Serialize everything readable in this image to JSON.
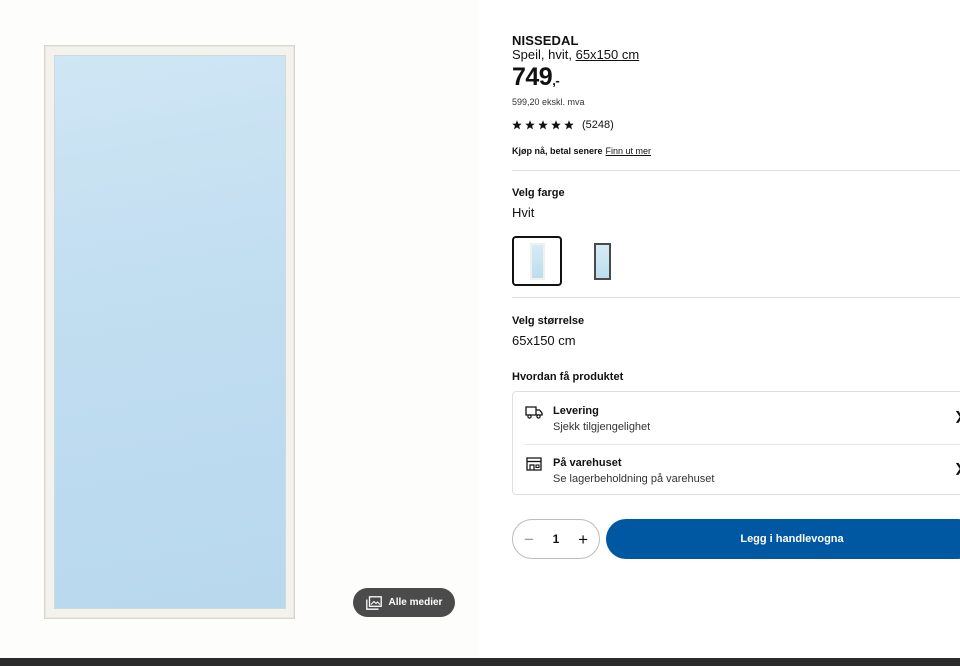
{
  "gallery": {
    "media_button_label": "Alle medier",
    "media_icon": "photo-gallery-icon"
  },
  "product": {
    "name": "NISSEDAL",
    "description_prefix": "Speil, hvit, ",
    "description_size": "65x150 cm",
    "price": "749",
    "price_suffix": ",-",
    "price_ex_vat": "599,20 ekskl. mva",
    "rating_stars": 5,
    "review_count": "(5248)",
    "bnpl_text": "Kjøp nå, betal senere",
    "bnpl_link": "Finn ut mer"
  },
  "color": {
    "heading": "Velg farge",
    "selected": "Hvit",
    "options": [
      "white-frame",
      "black-frame"
    ]
  },
  "size": {
    "heading": "Velg størrelse",
    "selected": "65x150 cm"
  },
  "fulfilment": {
    "heading": "Hvordan få produktet",
    "options": [
      {
        "title": "Levering",
        "subtitle": "Sjekk tilgjengelighet",
        "icon": "delivery-truck-icon"
      },
      {
        "title": "På varehuset",
        "subtitle": "Se lagerbeholdning på varehuset",
        "icon": "store-icon"
      }
    ]
  },
  "cart": {
    "quantity": "1",
    "add_label": "Legg i handlevogna"
  },
  "colors": {
    "accent": "#0058a3",
    "text": "#111111",
    "divider": "#dfdfdf"
  }
}
